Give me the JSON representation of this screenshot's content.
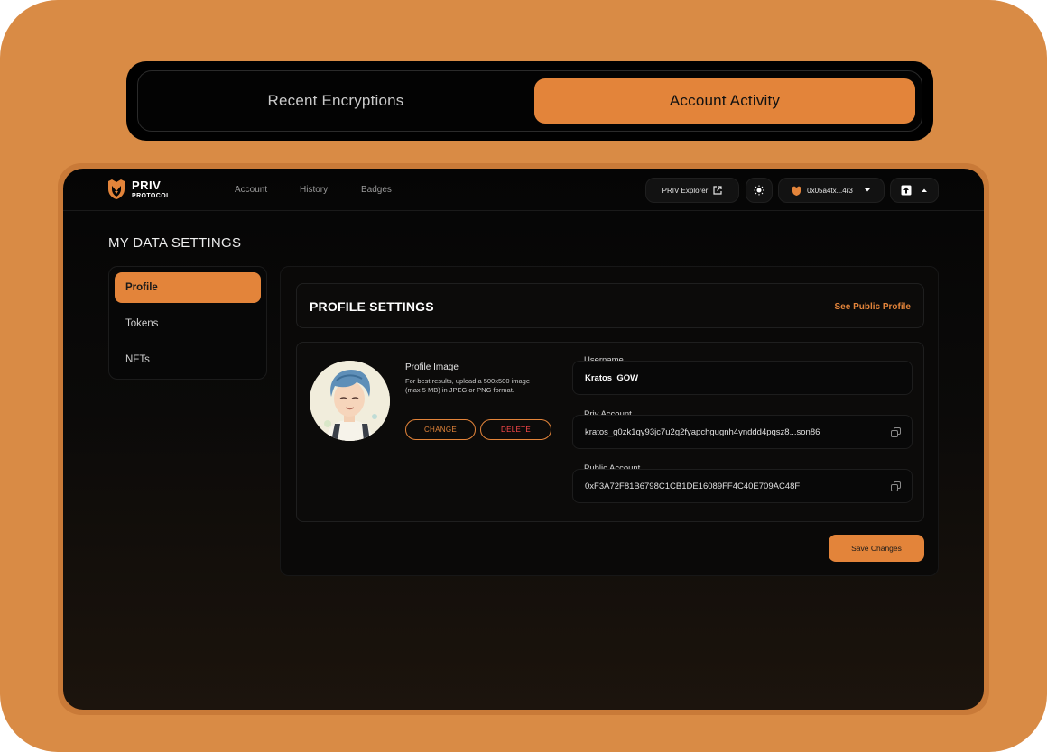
{
  "toggle": {
    "options": [
      {
        "label": "Recent Encryptions",
        "active": false
      },
      {
        "label": "Account Activity",
        "active": true
      }
    ]
  },
  "brand": {
    "title": "PRIV",
    "subtitle": "PROTOCOL",
    "accent": "#e3843a"
  },
  "nav": {
    "links": [
      "Account",
      "History",
      "Badges"
    ]
  },
  "toolbar": {
    "explorer_label": "PRIV Explorer",
    "wallet_address": "0x05a4tx...4r3",
    "theme_icon": "sun-icon",
    "upload_icon": "upload-icon"
  },
  "page": {
    "title": "MY DATA SETTINGS"
  },
  "sidebar": {
    "items": [
      {
        "label": "Profile",
        "active": true
      },
      {
        "label": "Tokens",
        "active": false
      },
      {
        "label": "NFTs",
        "active": false
      }
    ]
  },
  "profile": {
    "title": "PROFILE SETTINGS",
    "public_link": "See Public Profile",
    "image_label": "Profile Image",
    "image_help": "For best results, upload a 500x500 image (max 5 MB) in JPEG or PNG format.",
    "change_label": "CHANGE",
    "delete_label": "DELETE",
    "username_label": "Username",
    "username_value": "Kratos_GOW",
    "priv_label": "Priv Account",
    "priv_value": "kratos_g0zk1qy93jc7u2g2fyapchgugnh4ynddd4pqsz8...son86",
    "public_label": "Public Account",
    "public_value": "0xF3A72F81B6798C1CB1DE16089FF4C40E709AC48F",
    "save_label": "Save Changes"
  }
}
